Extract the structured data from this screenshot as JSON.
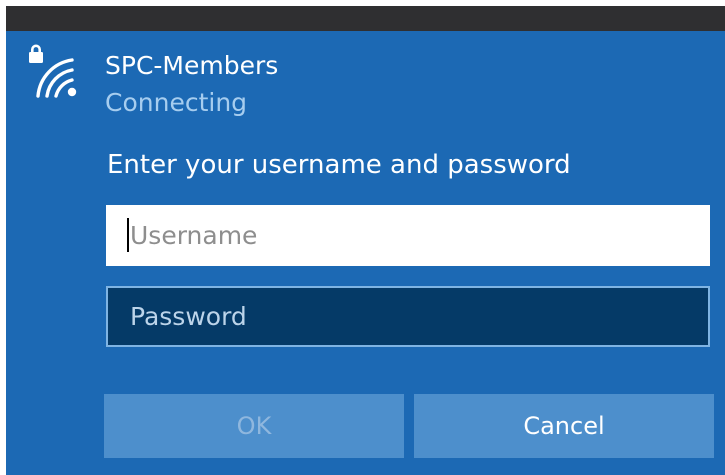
{
  "network": {
    "name": "SPC-Members",
    "status": "Connecting",
    "icon": "secured-wifi-icon"
  },
  "form": {
    "prompt": "Enter your username and password",
    "username": {
      "value": "",
      "placeholder": "Username"
    },
    "password": {
      "value": "",
      "placeholder": "Password"
    }
  },
  "buttons": {
    "ok_label": "OK",
    "ok_enabled": false,
    "cancel_label": "Cancel"
  },
  "colors": {
    "panel": "#1c69b4",
    "title_strip": "#2f2f31",
    "status_text": "#a6cdef",
    "password_field": "#053a67",
    "button": "#4d8fcc"
  }
}
